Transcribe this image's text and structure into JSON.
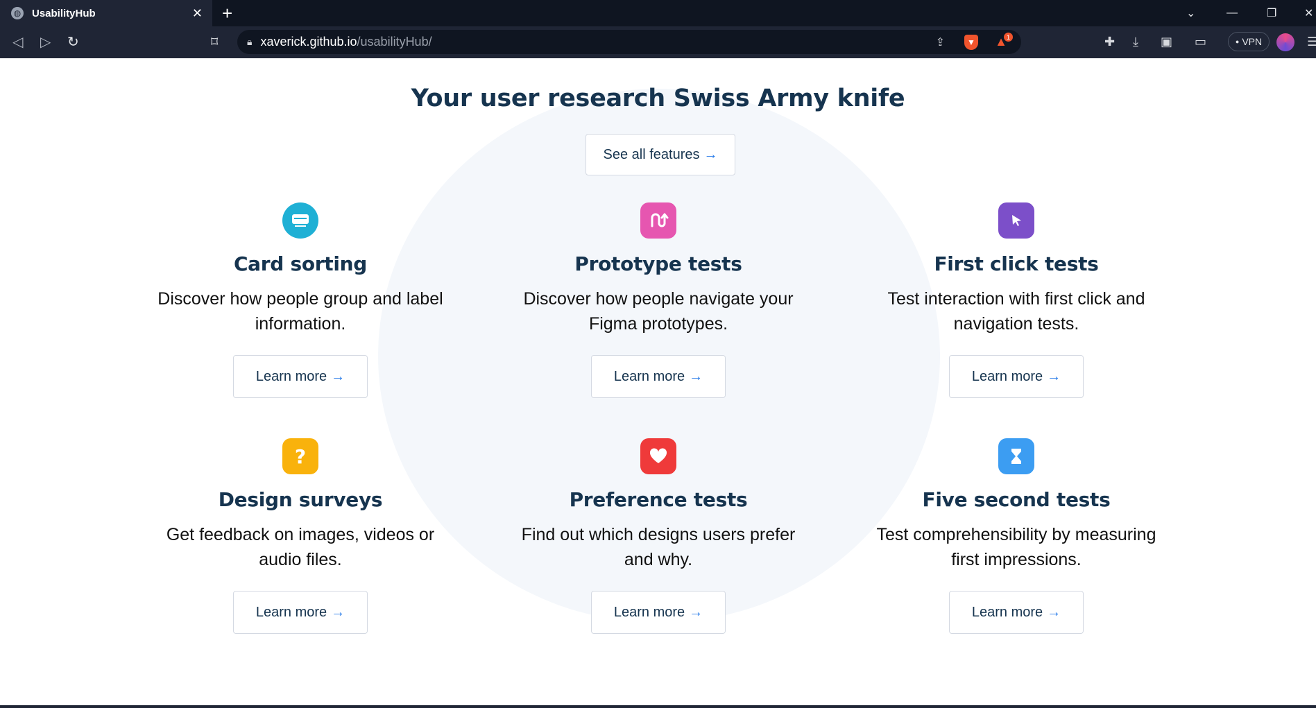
{
  "browser": {
    "tab_title": "UsabilityHub",
    "favicon": "globe-icon",
    "url_host": "xaverick.github.io",
    "url_path": "/usabilityHub/",
    "vpn_label": "VPN",
    "brave_badge": "1"
  },
  "page": {
    "headline": "Your user research Swiss Army knife",
    "see_all_label": "See all features",
    "arrow": "→",
    "features": [
      {
        "title": "Card sorting",
        "desc": "Discover how people group and label information.",
        "cta": "Learn more",
        "icon": "card-sort-icon",
        "color": "#1fb0d5"
      },
      {
        "title": "Prototype tests",
        "desc": "Discover how people navigate your Figma prototypes.",
        "cta": "Learn more",
        "icon": "prototype-icon",
        "color": "#e656b0"
      },
      {
        "title": "First click tests",
        "desc": "Test interaction with first click and navigation tests.",
        "cta": "Learn more",
        "icon": "cursor-icon",
        "color": "#7c4fc9"
      },
      {
        "title": "Design surveys",
        "desc": "Get feedback on images, videos or audio files.",
        "cta": "Learn more",
        "icon": "question-icon",
        "color": "#f9b20c"
      },
      {
        "title": "Preference tests",
        "desc": "Find out which designs users prefer and why.",
        "cta": "Learn more",
        "icon": "heart-icon",
        "color": "#ef3a3a"
      },
      {
        "title": "Five second tests",
        "desc": "Test comprehensibility by measuring first impressions.",
        "cta": "Learn more",
        "icon": "hourglass-icon",
        "color": "#3c9df2"
      }
    ]
  }
}
